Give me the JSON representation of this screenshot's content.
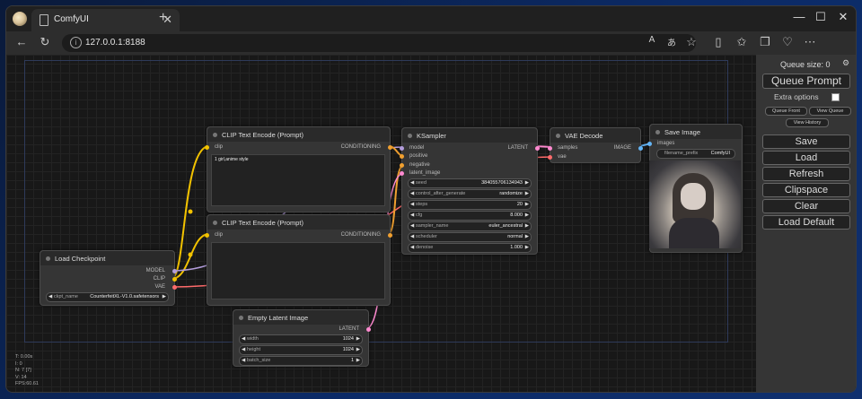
{
  "browser": {
    "tab_title": "ComfyUI",
    "tab_close": "✕",
    "new_tab": "+",
    "url": "127.0.0.1:8188",
    "minimize": "—",
    "maximize": "☐",
    "close": "✕"
  },
  "links_colors": {
    "clip": "#f2c200",
    "model": "#b39ddb",
    "vae": "#ff6b6b",
    "conditioning": "#f0a030",
    "latent": "#ff8ad0",
    "image": "#64b5f6"
  },
  "nodes": {
    "load_checkpoint": {
      "title": "Load Checkpoint",
      "out_model": "MODEL",
      "out_clip": "CLIP",
      "out_vae": "VAE",
      "ckpt_label": "ckpt_name",
      "ckpt_value": "CounterfeitXL-V1.0.safetensors"
    },
    "clip_pos": {
      "title": "CLIP Text Encode (Prompt)",
      "in_clip": "clip",
      "out": "CONDITIONING",
      "text": "1 girl,anime style"
    },
    "clip_neg": {
      "title": "CLIP Text Encode (Prompt)",
      "in_clip": "clip",
      "out": "CONDITIONING",
      "text": ""
    },
    "ksampler": {
      "title": "KSampler",
      "in_model": "model",
      "in_positive": "positive",
      "in_negative": "negative",
      "in_latent": "latent_image",
      "out": "LATENT",
      "widgets": [
        {
          "label": "seed",
          "value": "384055706134943"
        },
        {
          "label": "control_after_generate",
          "value": "randomize"
        },
        {
          "label": "steps",
          "value": "20"
        },
        {
          "label": "cfg",
          "value": "8.000"
        },
        {
          "label": "sampler_name",
          "value": "euler_ancestral"
        },
        {
          "label": "scheduler",
          "value": "normal"
        },
        {
          "label": "denoise",
          "value": "1.000"
        }
      ]
    },
    "vae_decode": {
      "title": "VAE Decode",
      "in_samples": "samples",
      "in_vae": "vae",
      "out": "IMAGE"
    },
    "save_image": {
      "title": "Save Image",
      "in_images": "images",
      "prefix_label": "filename_prefix",
      "prefix_value": "ComfyUI"
    },
    "empty_latent": {
      "title": "Empty Latent Image",
      "out": "LATENT",
      "widgets": [
        {
          "label": "width",
          "value": "1024"
        },
        {
          "label": "height",
          "value": "1024"
        },
        {
          "label": "batch_size",
          "value": "1"
        }
      ]
    }
  },
  "stats": [
    "T: 0.00s",
    "I: 0",
    "N: 7 [7]",
    "V: 14",
    "FPS:60.61"
  ],
  "menu": {
    "queue_size": "Queue size: 0",
    "queue_prompt": "Queue Prompt",
    "extra_options": "Extra options",
    "queue_front": "Queue Front",
    "view_queue": "View Queue",
    "view_history": "View History",
    "save": "Save",
    "load": "Load",
    "refresh": "Refresh",
    "clipspace": "Clipspace",
    "clear": "Clear",
    "load_default": "Load Default"
  }
}
